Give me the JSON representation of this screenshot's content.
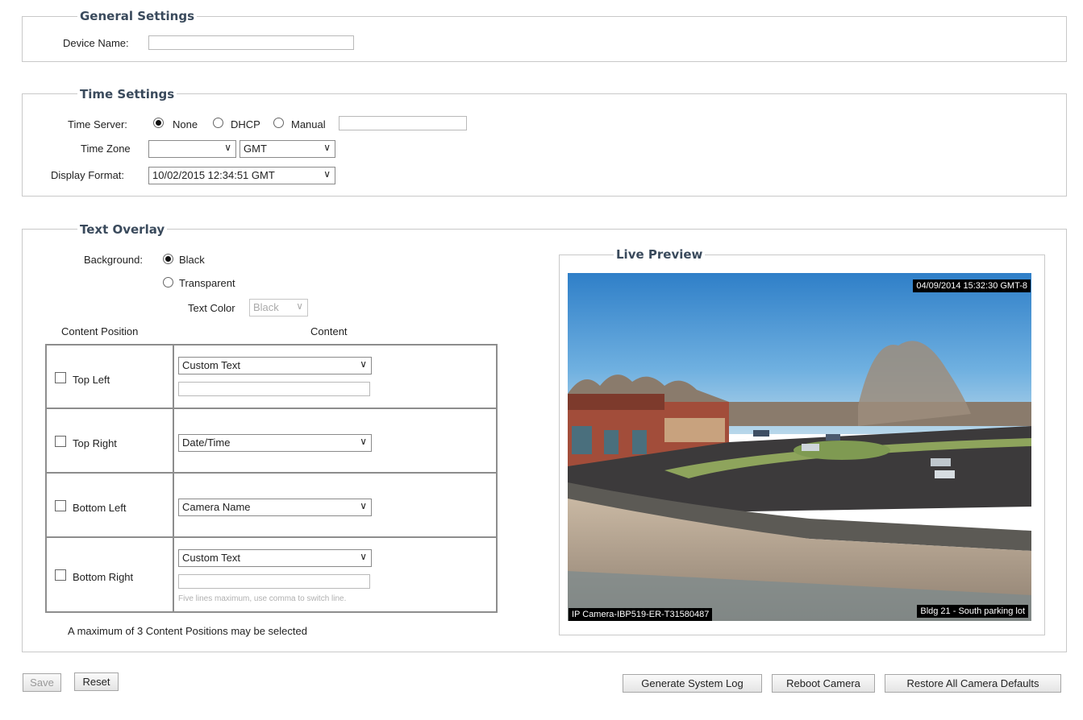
{
  "general": {
    "legend": "General Settings",
    "device_name_label": "Device Name:",
    "device_name_value": ""
  },
  "time": {
    "legend": "Time Settings",
    "time_server_label": "Time Server:",
    "options": [
      "None",
      "DHCP",
      "Manual"
    ],
    "selected": "None",
    "manual_value": "",
    "time_zone_label": "Time Zone",
    "time_zone_region": "",
    "time_zone_offset": "GMT",
    "display_format_label": "Display Format:",
    "display_format_value": "10/02/2015 12:34:51 GMT"
  },
  "overlay": {
    "legend": "Text Overlay",
    "background_label": "Background:",
    "background_options": [
      "Black",
      "Transparent"
    ],
    "background_selected": "Black",
    "text_color_label": "Text Color",
    "text_color_value": "Black",
    "col_position": "Content Position",
    "col_content": "Content",
    "rows": [
      {
        "position": "Top Left",
        "checked": false,
        "content": "Custom Text",
        "text": ""
      },
      {
        "position": "Top Right",
        "checked": false,
        "content": "Date/Time"
      },
      {
        "position": "Bottom Left",
        "checked": false,
        "content": "Camera Name"
      },
      {
        "position": "Bottom Right",
        "checked": false,
        "content": "Custom Text",
        "text": "",
        "hint": "Five lines maximum, use comma to switch line."
      }
    ],
    "max_note": "A maximum of 3 Content Positions may be selected"
  },
  "preview": {
    "legend": "Live Preview",
    "overlay_top_right": "04/09/2014 15:32:30 GMT-8",
    "overlay_bottom_left": "IP Camera-IBP519-ER-T31580487",
    "overlay_bottom_right": "Bldg 21 - South parking lot"
  },
  "buttons": {
    "save": "Save",
    "reset": "Reset",
    "generate_log": "Generate System Log",
    "reboot": "Reboot Camera",
    "restore": "Restore All Camera Defaults"
  },
  "icons": {
    "select_arrow": "chevron-down-icon"
  }
}
